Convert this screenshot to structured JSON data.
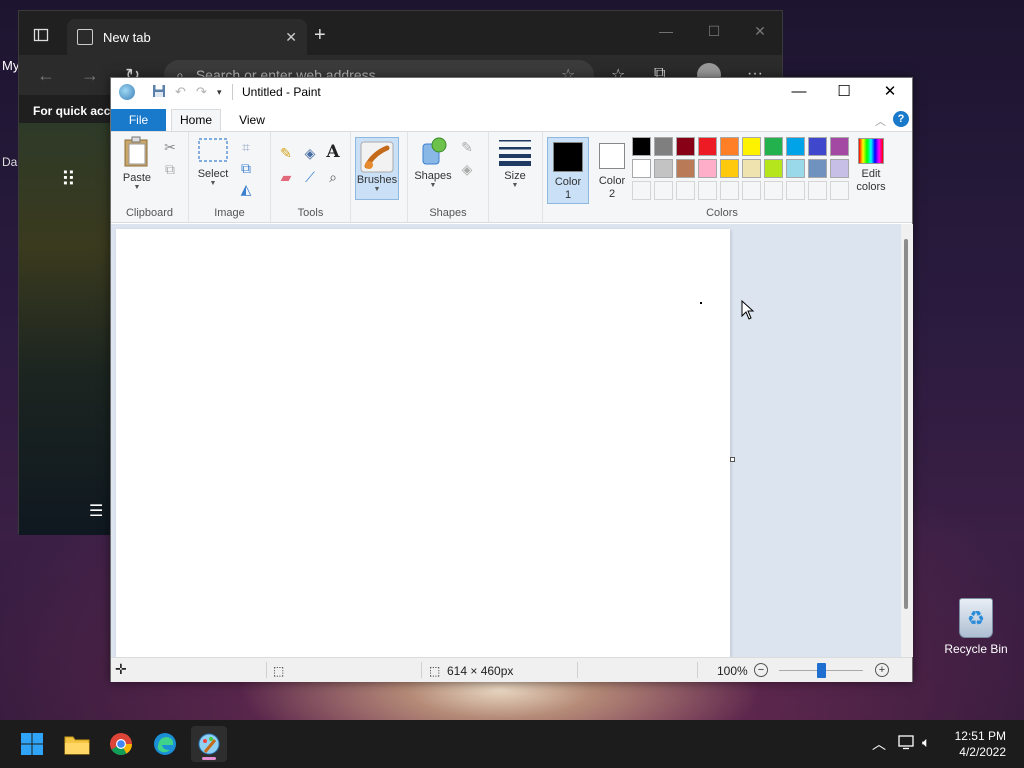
{
  "desktop": {
    "left_text_1": "My",
    "left_text_2": "Da",
    "recycle_bin_label": "Recycle Bin"
  },
  "edge": {
    "tab_title": "New tab",
    "address_placeholder": "Search or enter web address",
    "quick_access_text": "For quick acce"
  },
  "paint": {
    "window_title": "Untitled - Paint",
    "tabs": {
      "file": "File",
      "home": "Home",
      "view": "View"
    },
    "ribbon": {
      "clipboard": {
        "paste": "Paste",
        "group": "Clipboard"
      },
      "image": {
        "select": "Select",
        "group": "Image"
      },
      "tools": {
        "group": "Tools"
      },
      "brushes": {
        "label": "Brushes"
      },
      "shapes": {
        "label": "Shapes",
        "group": "Shapes"
      },
      "size": {
        "label": "Size"
      },
      "colors": {
        "color1_line1": "Color",
        "color1_line2": "1",
        "color2_line1": "Color",
        "color2_line2": "2",
        "edit_line1": "Edit",
        "edit_line2": "colors",
        "group": "Colors",
        "color1_value": "#000000",
        "color2_value": "#ffffff",
        "palette_row1": [
          "#000000",
          "#7f7f7f",
          "#880015",
          "#ed1c24",
          "#ff7f27",
          "#fff200",
          "#22b14c",
          "#00a2e8",
          "#3f48cc",
          "#a349a4"
        ],
        "palette_row2": [
          "#ffffff",
          "#c3c3c3",
          "#b97a57",
          "#ffaec9",
          "#ffc90e",
          "#efe4b0",
          "#b5e61d",
          "#99d9ea",
          "#7092be",
          "#c8bfe7"
        ]
      }
    },
    "status": {
      "dimensions": "614 × 460px",
      "zoom": "100%"
    }
  },
  "taskbar": {
    "time": "12:51 PM",
    "date": "4/2/2022"
  }
}
